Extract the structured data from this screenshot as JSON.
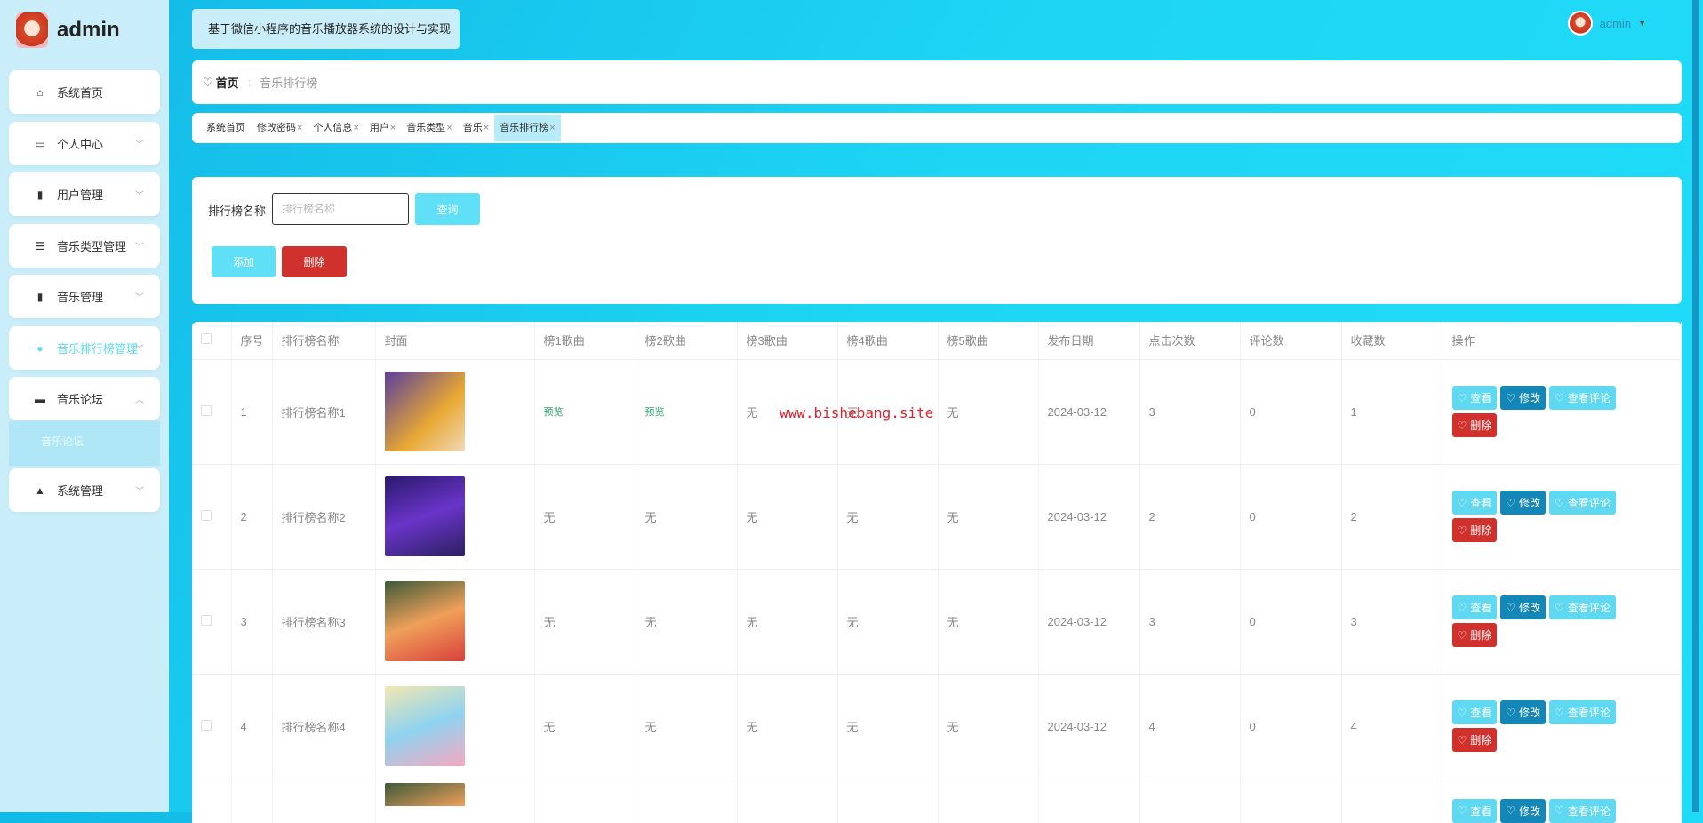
{
  "app": {
    "user": "admin",
    "title": "基于微信小程序的音乐播放器系统的设计与实现"
  },
  "sidebar": {
    "items": [
      {
        "label": "系统首页",
        "icon": "home-icon"
      },
      {
        "label": "个人中心",
        "icon": "wallet-icon"
      },
      {
        "label": "用户管理",
        "icon": "users-icon"
      },
      {
        "label": "音乐类型管理",
        "icon": "list-icon"
      },
      {
        "label": "音乐管理",
        "icon": "bar-chart-icon"
      },
      {
        "label": "音乐排行榜管理",
        "icon": "shield-icon"
      },
      {
        "label": "音乐论坛",
        "icon": "chat-icon"
      },
      {
        "label": "系统管理",
        "icon": "user-icon"
      }
    ],
    "submenu": "音乐论坛"
  },
  "breadcrumb": {
    "home": "首页",
    "sep": ":",
    "current": "音乐排行榜"
  },
  "tabs": [
    {
      "label": "系统首页",
      "close": ""
    },
    {
      "label": "修改密码",
      "close": "×"
    },
    {
      "label": "个人信息",
      "close": "×"
    },
    {
      "label": "用户",
      "close": "×"
    },
    {
      "label": "音乐类型",
      "close": "×"
    },
    {
      "label": "音乐",
      "close": "×"
    },
    {
      "label": "音乐排行榜",
      "close": "×"
    }
  ],
  "search": {
    "label": "排行榜名称",
    "placeholder": "排行榜名称",
    "query": "查询",
    "add": "添加",
    "delete": "删除"
  },
  "table": {
    "headers": [
      "序号",
      "排行榜名称",
      "封面",
      "榜1歌曲",
      "榜2歌曲",
      "榜3歌曲",
      "榜4歌曲",
      "榜5歌曲",
      "发布日期",
      "点击次数",
      "评论数",
      "收藏数",
      "操作"
    ],
    "actions": {
      "view": "查看",
      "edit": "修改",
      "comments": "查看评论",
      "delete": "删除"
    },
    "rows": [
      {
        "no": "1",
        "name": "排行榜名称1",
        "s1": "预览",
        "s2": "预览",
        "s3": "无",
        "s4": "无",
        "s5": "无",
        "date": "2024-03-12",
        "clicks": "3",
        "comments": "0",
        "favs": "1"
      },
      {
        "no": "2",
        "name": "排行榜名称2",
        "s1": "无",
        "s2": "无",
        "s3": "无",
        "s4": "无",
        "s5": "无",
        "date": "2024-03-12",
        "clicks": "2",
        "comments": "0",
        "favs": "2"
      },
      {
        "no": "3",
        "name": "排行榜名称3",
        "s1": "无",
        "s2": "无",
        "s3": "无",
        "s4": "无",
        "s5": "无",
        "date": "2024-03-12",
        "clicks": "3",
        "comments": "0",
        "favs": "3"
      },
      {
        "no": "4",
        "name": "排行榜名称4",
        "s1": "无",
        "s2": "无",
        "s3": "无",
        "s4": "无",
        "s5": "无",
        "date": "2024-03-12",
        "clicks": "4",
        "comments": "0",
        "favs": "4"
      }
    ]
  },
  "watermark": "www.bishebang.site",
  "colors": {
    "accent": "#5fd8f2",
    "edit": "#1287b8",
    "danger": "#d1312c"
  }
}
